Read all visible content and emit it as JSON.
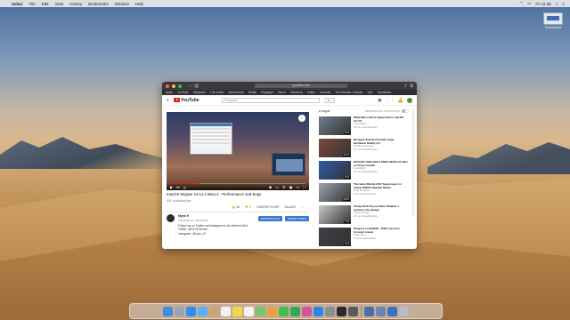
{
  "menubar": {
    "app_name": "Safari",
    "items": [
      "File",
      "Edit",
      "View",
      "History",
      "Bookmarks",
      "Window",
      "Help"
    ],
    "clock": "Fri 11:36"
  },
  "desktop": {
    "file_label": "Screenshot"
  },
  "browser": {
    "url": "youtube.com",
    "favorites": [
      "Apple",
      "YouTube",
      "Wikipedia",
      "Cult of Mac",
      "MacRumors",
      "Reddit",
      "Engadget",
      "Yahoo",
      "Facebook",
      "Twitter",
      "LinkedIn",
      "The Weather Channel",
      "Yelp",
      "TripAdvisor"
    ]
  },
  "youtube": {
    "logo_text": "YouTube",
    "search_placeholder": "Pesquisar",
    "video": {
      "title": "macOS Mojave 10.14.2 Beta 2 - Performance and Bugs",
      "views": "801 visualizações",
      "progress_fraction": 0.22,
      "actions": [
        "👍 38",
        "👎 1",
        "COMPARTILHAR",
        "SALVAR",
        "..."
      ],
      "time_badge": "i"
    },
    "channel": {
      "name": "Nyxx 9",
      "date": "Publicado em 19/11/2018",
      "subscribe": "ESTATÍSTICAS",
      "edit": "EDITAR VÍDEO",
      "description": [
        "Follow me on Twitter and Instagram to be informed first:",
        "Twitter: @NYXX9vnline",
        "Instagram: @nyxx_c9"
      ]
    },
    "up_next": {
      "label": "A seguir",
      "autoplay": "REPRODUÇÃO AUTOMÁTICA"
    },
    "recommendations": [
      {
        "title": "What Macs will be Supported in macOS 10.14?",
        "channel": "Luke Miani",
        "views": "33 mil visualizações",
        "duration": "8:14",
        "color": "#6f7d8c"
      },
      {
        "title": "Mr Apple Branded Fanatic Cage - Hardtenet Reality 3.0",
        "channel": "Hardbeat Reality",
        "views": "14 mil visualizações",
        "duration": "12:01",
        "color": "#7a4a3b"
      },
      {
        "title": "BUDGET AND CHALLENGE $1000 old tabs on Finest install!",
        "channel": "HotelMahl",
        "views": "22 mil visualizações",
        "duration": "5:22",
        "color": "#2f5ba7"
      },
      {
        "title": "The latest Mobile 2017 Supertogers in review $300K Flagship Model",
        "channel": "Auto Reviews",
        "views": "6 mil visualizações",
        "duration": "10:10",
        "color": "#9aa3ac"
      },
      {
        "title": "Cheap Rolls Royce Silver Shadow 1 review in the garage",
        "channel": "Tamil Garage",
        "views": "18 mil visualizações",
        "duration": "7:45",
        "color": "#c9c9c9"
      },
      {
        "title": "Peugeot e-LEGEND - 360m Top Cars Concept review",
        "channel": "Daily Cars",
        "views": "9 mil visualizações",
        "duration": "4:33",
        "color": "#3e3e44"
      }
    ]
  },
  "dock": {
    "icons": [
      {
        "name": "finder-icon",
        "color": "#3d8de0"
      },
      {
        "name": "launchpad-icon",
        "color": "#9aa5b3"
      },
      {
        "name": "safari-icon",
        "color": "#2f8ef0"
      },
      {
        "name": "mail-icon",
        "color": "#5ab0f2"
      },
      {
        "name": "contacts-icon",
        "color": "#c9a774"
      },
      {
        "name": "calendar-icon",
        "color": "#f2f2f2"
      },
      {
        "name": "notes-icon",
        "color": "#f6d64b"
      },
      {
        "name": "reminders-icon",
        "color": "#f3f3f3"
      },
      {
        "name": "maps-icon",
        "color": "#7cc36b"
      },
      {
        "name": "photos-icon",
        "color": "#e8a13c"
      },
      {
        "name": "messages-icon",
        "color": "#3fbf4a"
      },
      {
        "name": "facetime-icon",
        "color": "#34a853"
      },
      {
        "name": "itunes-icon",
        "color": "#d8519b"
      },
      {
        "name": "appstore-icon",
        "color": "#2a86e8"
      },
      {
        "name": "prefs-icon",
        "color": "#8a8f96"
      },
      {
        "name": "terminal-icon",
        "color": "#2b2b2b"
      },
      {
        "name": "activity-icon",
        "color": "#5a5a5a"
      },
      {
        "name": "screenshot-icon",
        "color": "#4a6ea8"
      },
      {
        "name": "window-icon",
        "color": "#6a86b5"
      },
      {
        "name": "downloads-icon",
        "color": "#3a72c4"
      },
      {
        "name": "trash-icon",
        "color": "#b9bcc2"
      }
    ]
  }
}
